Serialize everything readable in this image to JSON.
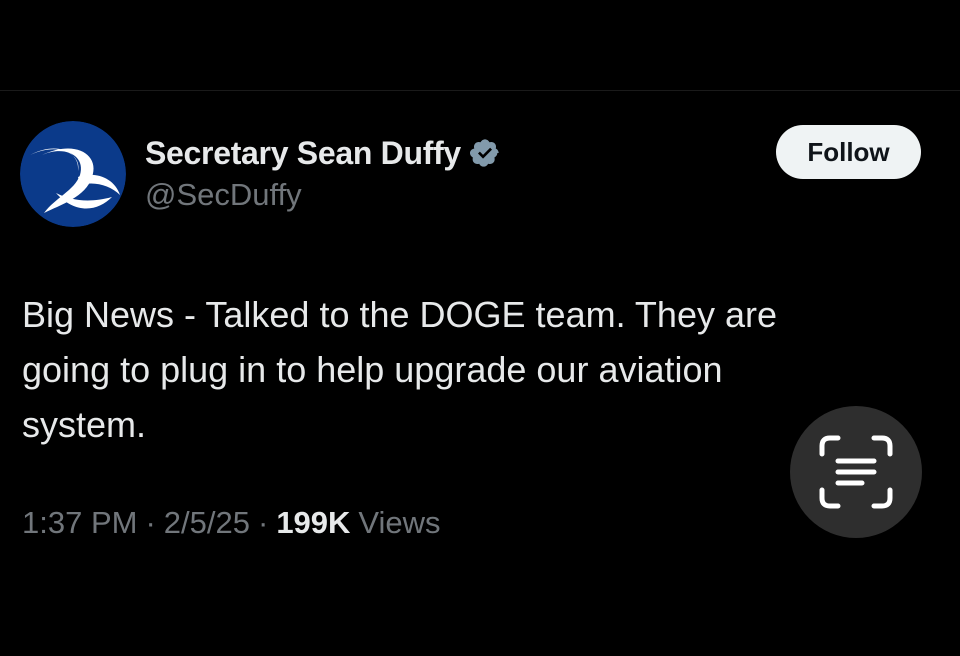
{
  "author": {
    "display_name": "Secretary Sean Duffy",
    "handle": "@SecDuffy",
    "verified_icon": "verified-badge-icon",
    "avatar_icon": "dot-emblem-avatar",
    "avatar_bg": "#0b3a8a"
  },
  "follow_button": {
    "label": "Follow"
  },
  "tweet": {
    "lines": [
      "Big News - Talked to the DOGE team. They are",
      "going to plug in to help upgrade our aviation",
      "system."
    ]
  },
  "meta": {
    "time": "1:37 PM",
    "separator": "·",
    "date": "2/5/25",
    "views_count": "199K",
    "views_label": "Views"
  },
  "overlay": {
    "icon": "text-scan-icon"
  },
  "colors": {
    "background": "#000000",
    "text": "#e7e9ea",
    "secondary_text": "#71767b",
    "button_bg": "#eff3f4"
  }
}
